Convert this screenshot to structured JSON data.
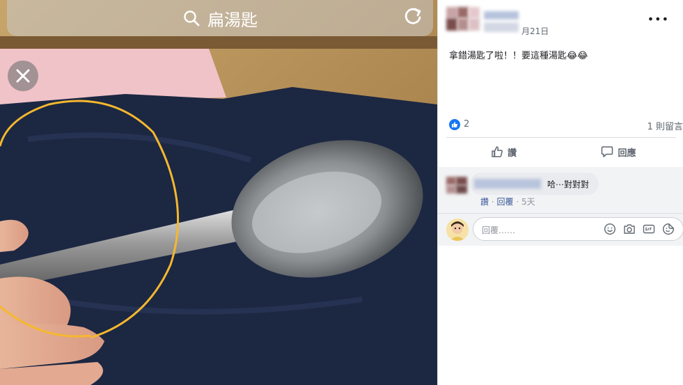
{
  "photo": {
    "search_query": "扁湯匙",
    "icons": {
      "search": "search-icon",
      "reload": "reload-icon",
      "close": "close-icon"
    }
  },
  "post": {
    "date": "月21日",
    "more": "•••",
    "text": "拿錯湯匙了啦！！要這種湯匙😂😂",
    "like_count": "2",
    "comment_count": "1 則留言",
    "actions": {
      "like": "讚",
      "comment": "回應"
    }
  },
  "comment": {
    "text": "哈⋯對對對",
    "like": "讚",
    "reply": "回覆",
    "dot": "·",
    "ago": "5天"
  },
  "reply_box": {
    "placeholder": "回覆……"
  },
  "colors": {
    "facebook_blue": "#1877f2",
    "link": "#385898",
    "circle_annotation": "#f5b82e"
  }
}
